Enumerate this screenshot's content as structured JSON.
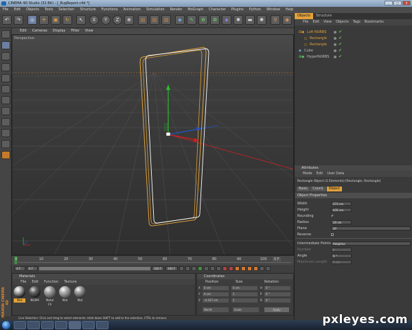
{
  "window": {
    "title": "CINEMA 4D Studio (32 Bit) - [_BugReport.c4d *]",
    "buttons": [
      "_",
      "□",
      "X"
    ]
  },
  "menubar": [
    "File",
    "Edit",
    "Objects",
    "Tools",
    "Selection",
    "Structure",
    "Functions",
    "Animation",
    "Simulation",
    "Render",
    "MoGraph",
    "Character",
    "Plugins",
    "Python",
    "Window",
    "Help"
  ],
  "viewport": {
    "menu": [
      "Edit",
      "Cameras",
      "Display",
      "Filter",
      "View"
    ],
    "label": "Perspective"
  },
  "timeline": {
    "ticks": [
      "0",
      "10",
      "20",
      "30",
      "40",
      "50",
      "60",
      "70",
      "80",
      "90",
      "100"
    ],
    "current_frame": "0 F",
    "start": "0 F",
    "preview_start": "0 F",
    "preview_end": "100 F",
    "end": "100 F"
  },
  "materials": {
    "title": "Materials",
    "menu": [
      "File",
      "Edit",
      "Function",
      "Texture"
    ],
    "items": [
      {
        "label": "Mat"
      },
      {
        "label": "NORM"
      },
      {
        "label": "Metal Ch"
      },
      {
        "label": "Mat"
      },
      {
        "label": "Mat"
      }
    ]
  },
  "coordinates": {
    "title": "Coordinates",
    "headers": [
      "Position",
      "Size",
      "Rotation"
    ],
    "rows": [
      {
        "axis": "X",
        "pos": "0 cm",
        "size": "0 cm",
        "rot_label": "H",
        "rot": "0 °"
      },
      {
        "axis": "Y",
        "pos": "0 cm",
        "size": "1",
        "rot_label": "P",
        "rot": "0 °"
      },
      {
        "axis": "Z",
        "pos": "-4.337 cm",
        "size": "1",
        "rot_label": "B",
        "rot": "0 °"
      }
    ],
    "mode1": "World",
    "mode2": "Scale",
    "apply": "Apply"
  },
  "status": "Live Selection: Click and drag to select elements. Hold down SHIFT to add to the selection, CTRL to remove.",
  "object_manager": {
    "tabs": [
      "Objects",
      "Structure"
    ],
    "menu": [
      "File",
      "Edit",
      "View",
      "Objects",
      "Tags",
      "Bookmarks"
    ],
    "items": [
      {
        "name": "Loft NURBS",
        "color": "#e0a23a"
      },
      {
        "name": "Rectangle",
        "color": "#e0a23a"
      },
      {
        "name": "Rectangle",
        "color": "#e0a23a"
      },
      {
        "name": "Cube",
        "color": "#bdbdbd"
      },
      {
        "name": "HyperNURBS",
        "color": "#bdbdbd"
      }
    ]
  },
  "attributes": {
    "title": "Attributes",
    "menu": [
      "Mode",
      "Edit",
      "User Data"
    ],
    "object_title": "Rectangle Object (2 Elements) [Rectangle, Rectangle]",
    "tabs": [
      "Basic",
      "Coord.",
      "Object"
    ],
    "section": "Object Properties",
    "fields": [
      {
        "label": "Width",
        "value": "272 cm"
      },
      {
        "label": "Height",
        "value": "435 cm"
      },
      {
        "label": "Rounding",
        "value": "✔"
      },
      {
        "label": "Radius",
        "value": "20 cm"
      },
      {
        "label": "Plane",
        "value": "XY"
      },
      {
        "label": "Reverse",
        "value": ""
      }
    ],
    "fields2": [
      {
        "label": "Intermediate Points",
        "value": "Adaptive"
      },
      {
        "label": "Number",
        "value": "8"
      },
      {
        "label": "Angle",
        "value": "5 °"
      },
      {
        "label": "Maximum Length",
        "value": "5 cm"
      }
    ]
  },
  "branding": {
    "maxon": "MAXON CINEMA 4D"
  },
  "watermark": "pxleyes.com",
  "colors": {
    "accent": "#e2a23a",
    "spline_orange": "#e0a23a",
    "axis_y": "#2dbb2d",
    "axis_x": "#cc2222",
    "axis_z": "#2255cc"
  }
}
